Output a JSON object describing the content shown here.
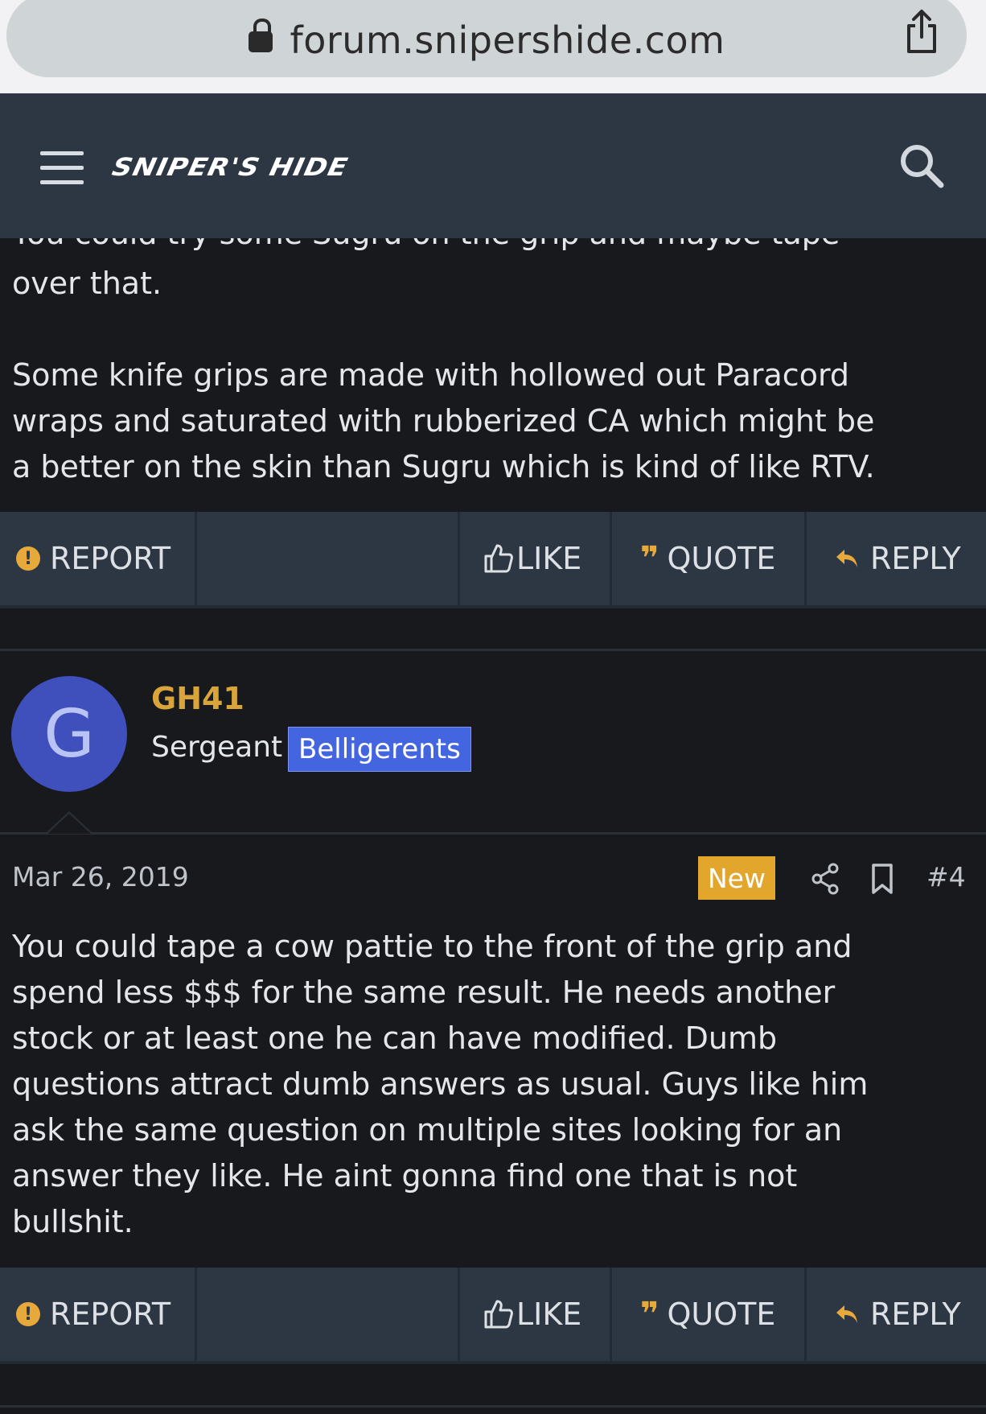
{
  "browser": {
    "url": "forum.snipershide.com"
  },
  "header": {
    "logo": "SNIPER'S HIDE"
  },
  "posts": [
    {
      "body_cut_line": "You could try some Sugru on the grip and maybe tape",
      "body": "over that.\n\nSome knife grips are made with hollowed out Paracord\nwraps and saturated with rubberized CA which might be\na better on the skin than Sugru which is kind of like RTV."
    },
    {
      "author": "GH41",
      "avatar_letter": "G",
      "rank": "Sergeant",
      "group_badge": "Belligerents",
      "date": "Mar 26, 2019",
      "new_label": "New",
      "post_number": "#4",
      "body": "You could tape a cow pattie to the front of the grip and\nspend less $$$ for the same result. He needs another\nstock or at least one he can have modified. Dumb\nquestions attract dumb answers as usual. Guys like him\nask the same question on multiple sites looking for an\nanswer they like. He aint gonna find one that is not\nbullshit."
    }
  ],
  "actions": {
    "report": "REPORT",
    "like": "LIKE",
    "quote": "QUOTE",
    "reply": "REPLY"
  },
  "colors": {
    "header_bg": "#2d3744",
    "page_bg": "#17191d",
    "username": "#d9a53a",
    "badge_bg": "#4465e0",
    "new_badge": "#e3a62c"
  }
}
